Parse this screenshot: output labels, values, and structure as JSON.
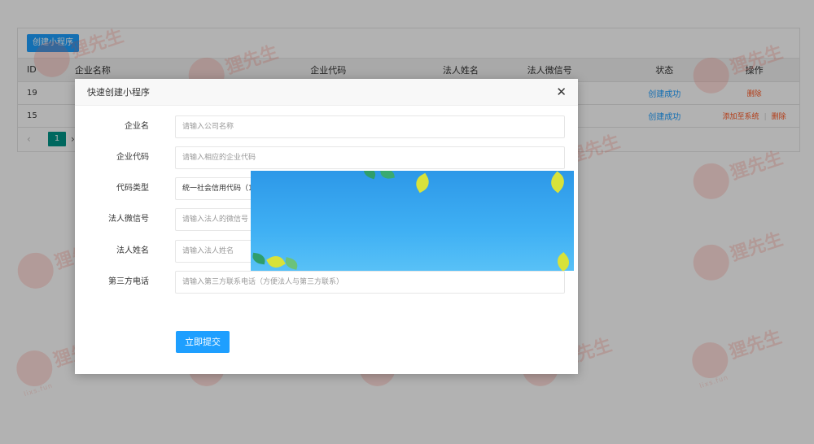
{
  "toolbar": {
    "create_label": "创建小程序"
  },
  "table": {
    "headers": {
      "id": "ID",
      "name": "企业名称",
      "code": "企业代码",
      "person": "法人姓名",
      "wechat": "法人微信号",
      "status": "状态",
      "op": "操作"
    },
    "rows": [
      {
        "id": "19",
        "status": "创建成功",
        "op_delete": "删除"
      },
      {
        "id": "15",
        "status": "创建成功",
        "op_add": "添加至系统",
        "op_delete": "删除"
      }
    ]
  },
  "pager": {
    "current": "1",
    "prev_icon": "chevron-left-icon",
    "next_icon": "chevron-right-icon"
  },
  "watermark": {
    "text": "狸先生",
    "sub": "lixs.fun"
  },
  "modal": {
    "title": "快速创建小程序",
    "close_icon": "close-icon",
    "fields": {
      "company_name": {
        "label": "企业名",
        "placeholder": "请输入公司名称"
      },
      "company_code": {
        "label": "企业代码",
        "placeholder": "请输入相应的企业代码"
      },
      "code_type": {
        "label": "代码类型",
        "value": "统一社会信用代码（18"
      },
      "wechat": {
        "label": "法人微信号",
        "placeholder": "请输入法人的微信号"
      },
      "person_name": {
        "label": "法人姓名",
        "placeholder": "请输入法人姓名"
      },
      "phone": {
        "label": "第三方电话",
        "placeholder": "请输入第三方联系电话（方便法人与第三方联系）"
      }
    },
    "submit_label": "立即提交"
  },
  "colors": {
    "primary": "#1e9fff",
    "danger": "#ff5722",
    "pager_active": "#009688"
  }
}
